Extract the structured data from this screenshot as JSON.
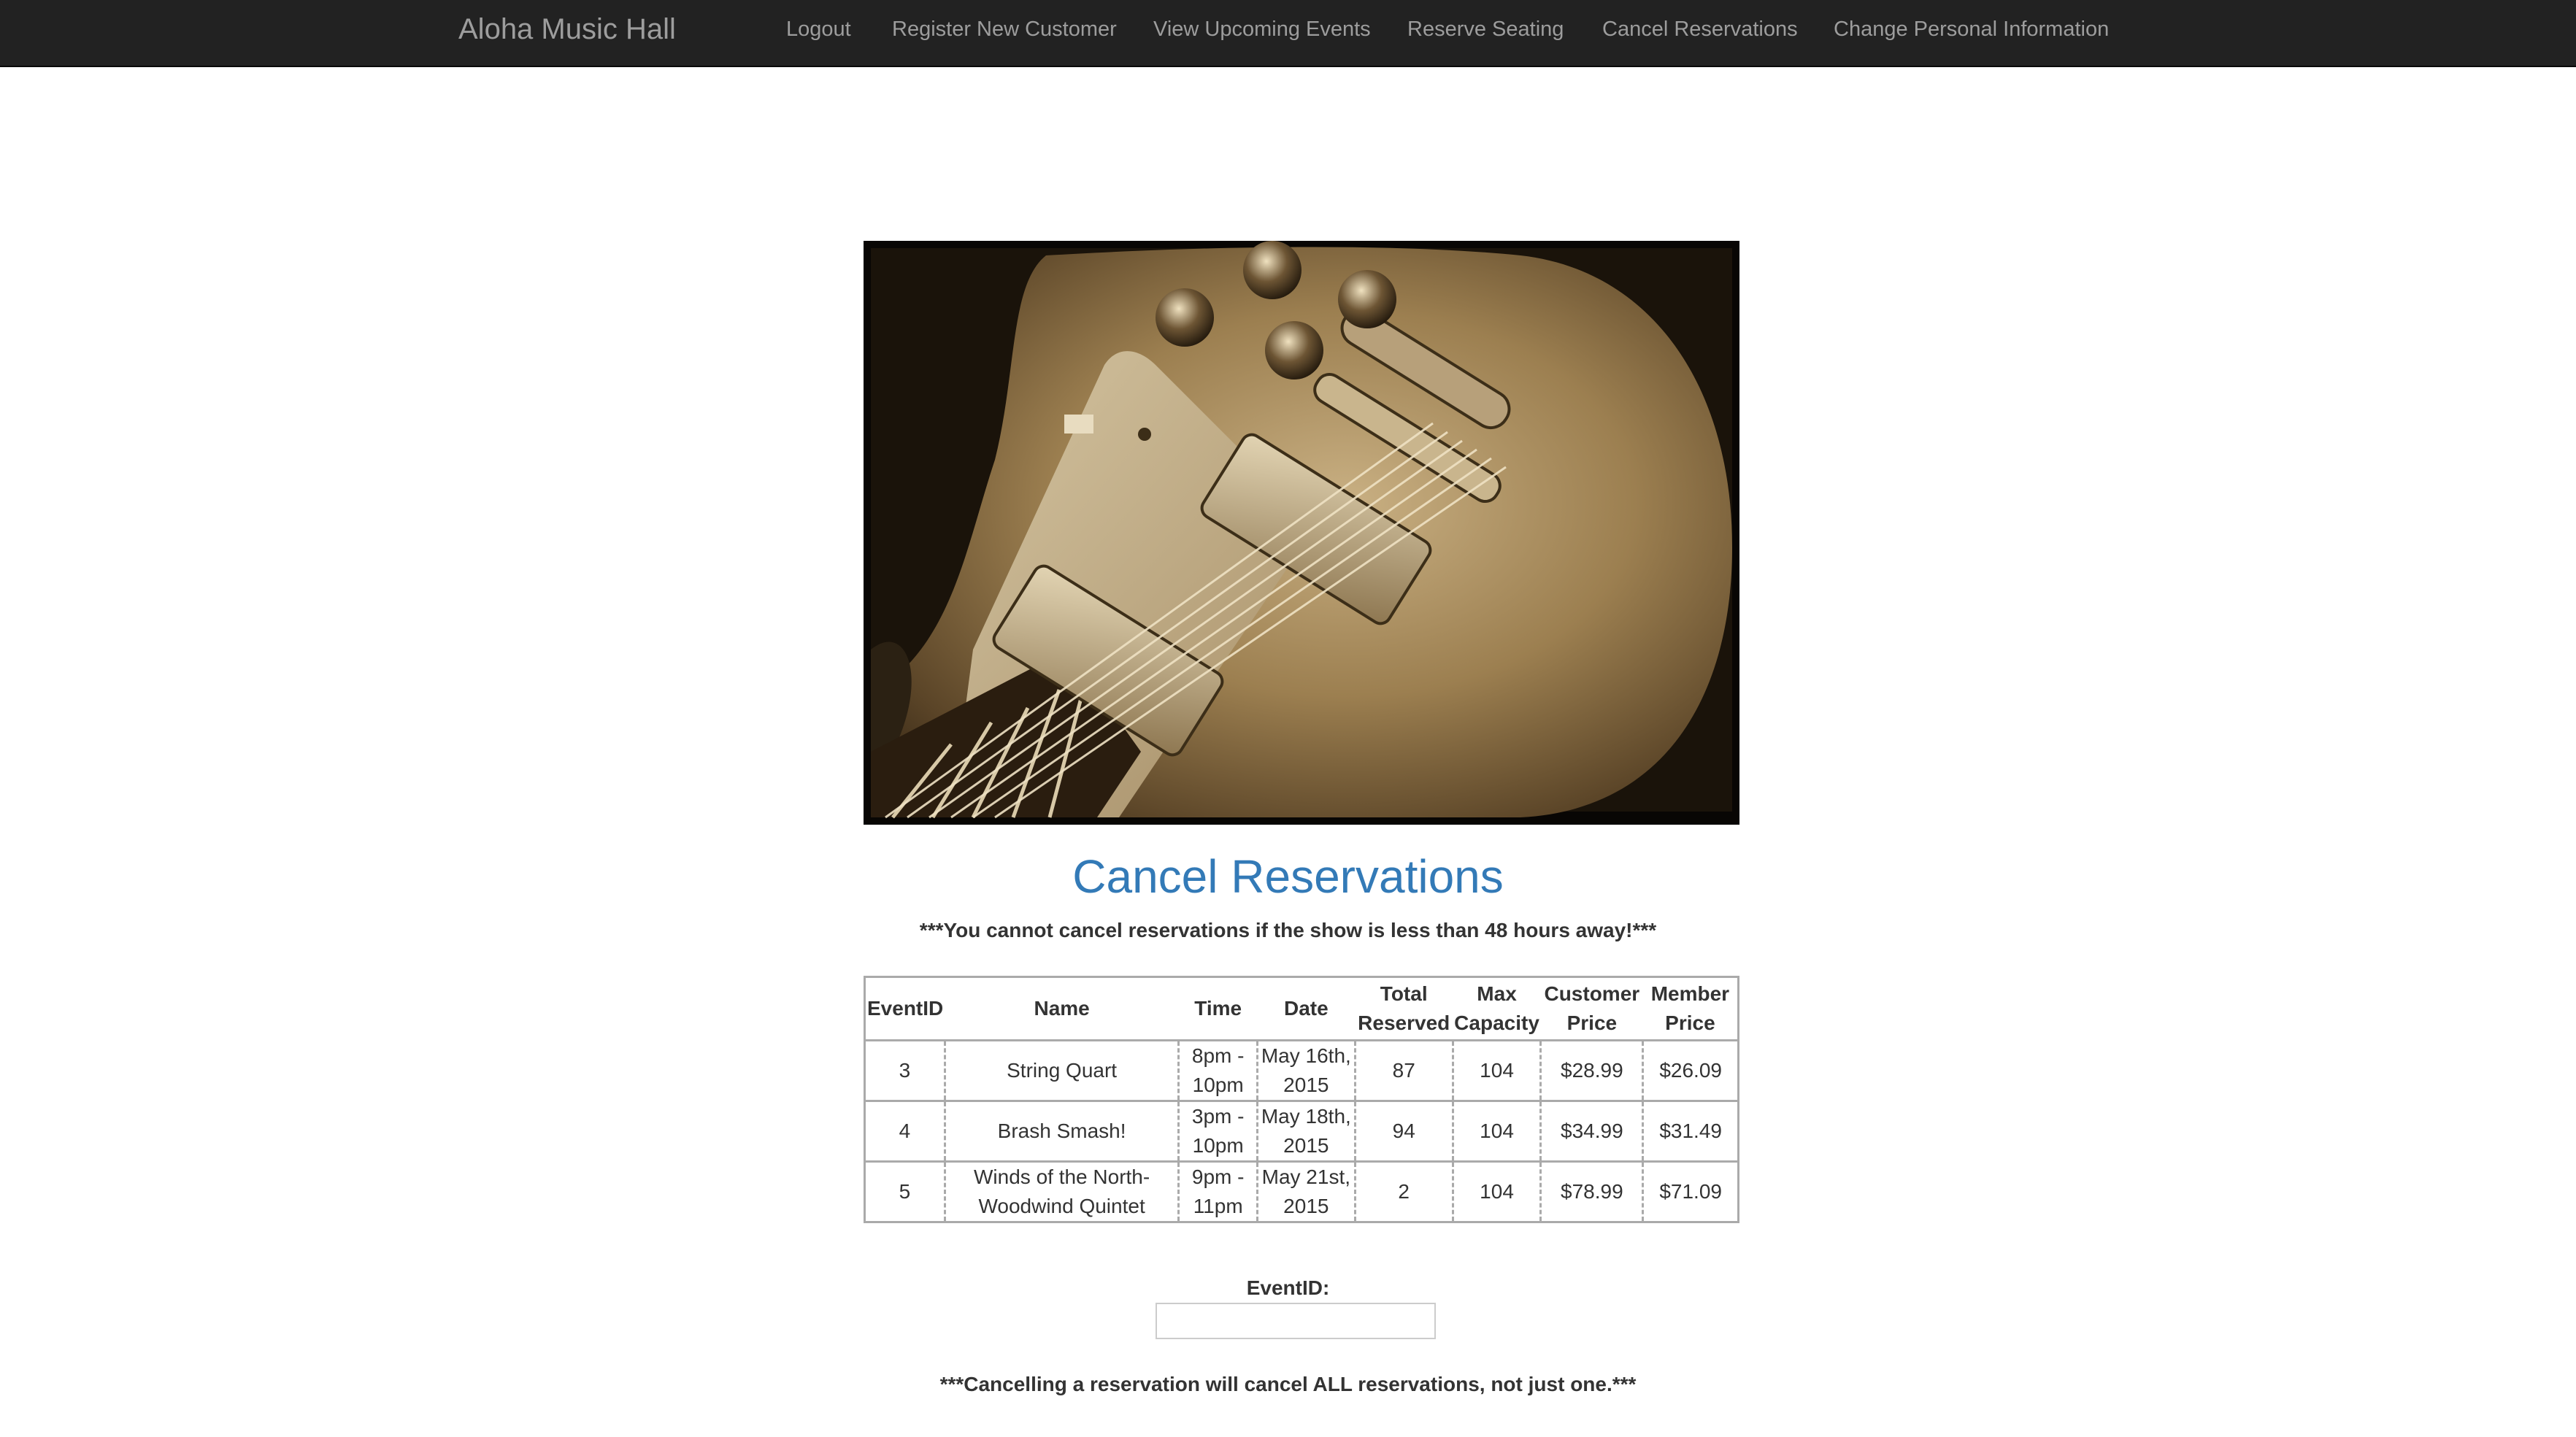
{
  "navbar": {
    "brand": "Aloha Music Hall",
    "links": [
      {
        "label": "Logout"
      },
      {
        "label": "Register New Customer"
      },
      {
        "label": "View Upcoming Events"
      },
      {
        "label": "Reserve Seating"
      },
      {
        "label": "Cancel Reservations"
      },
      {
        "label": "Change Personal Information"
      }
    ],
    "bg_color": "#222222",
    "link_color": "#9d9d9d"
  },
  "hero": {
    "icon": "electric-guitar-photo",
    "tone": "sepia"
  },
  "page": {
    "title": "Cancel Reservations",
    "title_color": "#337ab7",
    "warning_top": "***You cannot cancel reservations if the show is less than 48 hours away!***",
    "warning_bottom": "***Cancelling a reservation will cancel ALL reservations, not just one.***"
  },
  "table": {
    "headers": [
      "EventID",
      "Name",
      "Time",
      "Date",
      "Total Reserved",
      "Max Capacity",
      "Customer Price",
      "Member Price"
    ],
    "rows": [
      [
        "3",
        "String Quart",
        "8pm - 10pm",
        "May 16th, 2015",
        "87",
        "104",
        "$28.99",
        "$26.09"
      ],
      [
        "4",
        "Brash Smash!",
        "3pm - 10pm",
        "May 18th, 2015",
        "94",
        "104",
        "$34.99",
        "$31.49"
      ],
      [
        "5",
        "Winds of the North- Woodwind Quintet",
        "9pm - 11pm",
        "May 21st, 2015",
        "2",
        "104",
        "$78.99",
        "$71.09"
      ]
    ]
  },
  "form": {
    "eventid_label": "EventID:",
    "eventid_value": ""
  }
}
